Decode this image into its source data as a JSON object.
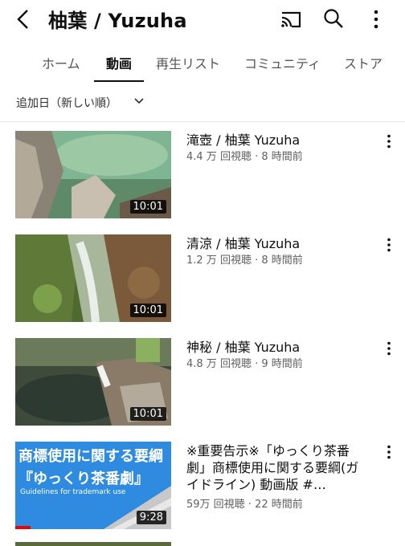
{
  "header": {
    "title": "柚葉 / Yuzuha",
    "icons": [
      "back-arrow-icon",
      "cast-icon",
      "search-icon",
      "more-vert-icon"
    ]
  },
  "tabs": [
    {
      "label": "ホーム"
    },
    {
      "label": "動画",
      "active": true
    },
    {
      "label": "再生リスト"
    },
    {
      "label": "コミュニティ"
    },
    {
      "label": "ストア"
    }
  ],
  "sort": {
    "label": "追加日（新しい順）"
  },
  "videos": [
    {
      "title": "滝壺 / 柚葉 Yuzuha",
      "meta": "4.4 万 回視聴 · 8 時間前",
      "duration": "10:01"
    },
    {
      "title": "清涼 / 柚葉 Yuzuha",
      "meta": "1.2 万 回視聴 · 8 時間前",
      "duration": "10:01"
    },
    {
      "title": "神秘 / 柚葉 Yuzuha",
      "meta": "4.8 万 回視聴 · 9 時間前",
      "duration": "10:01"
    },
    {
      "title": "※重要告示※「ゆっくり茶番劇」商標使用に関する要綱(ガイドライン) 動画版 #…",
      "meta": "59万 回視聴 · 22 時間前",
      "duration": "9:28",
      "thumb_text": {
        "line1": "商標使用に関する要綱",
        "line2": "『ゆっくり茶番劇』",
        "line3": "Guidelines for trademark use"
      },
      "watched_fraction": 0.1
    }
  ],
  "colors": {
    "accent": "#0f0f0f",
    "secondary_text": "#606060",
    "progress": "#ee0000"
  }
}
